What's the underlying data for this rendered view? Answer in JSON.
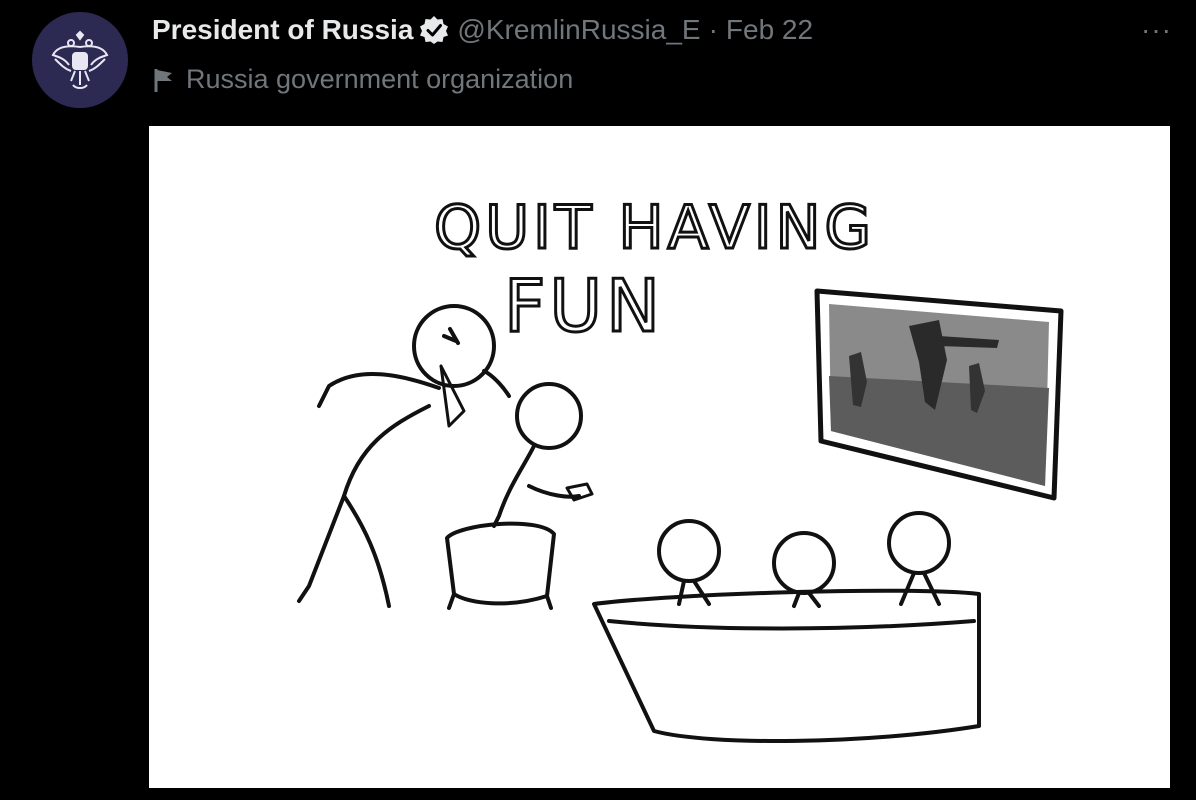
{
  "tweet": {
    "author": {
      "display_name": "President of Russia",
      "handle": "@KremlinRussia_E",
      "verified": true,
      "avatar_icon": "double-headed-eagle-emblem-icon"
    },
    "separator": "·",
    "date": "Feb 22",
    "more_label": "···",
    "affiliation": {
      "icon": "flag-icon",
      "label": "Russia government organization"
    },
    "media": {
      "caption_line1": "QUIT HAVING",
      "caption_line2": "FUN"
    }
  },
  "colors": {
    "background": "#000000",
    "primary_text": "#e7e9ea",
    "secondary_text": "#71767b",
    "avatar_bg": "#2c2a52"
  }
}
